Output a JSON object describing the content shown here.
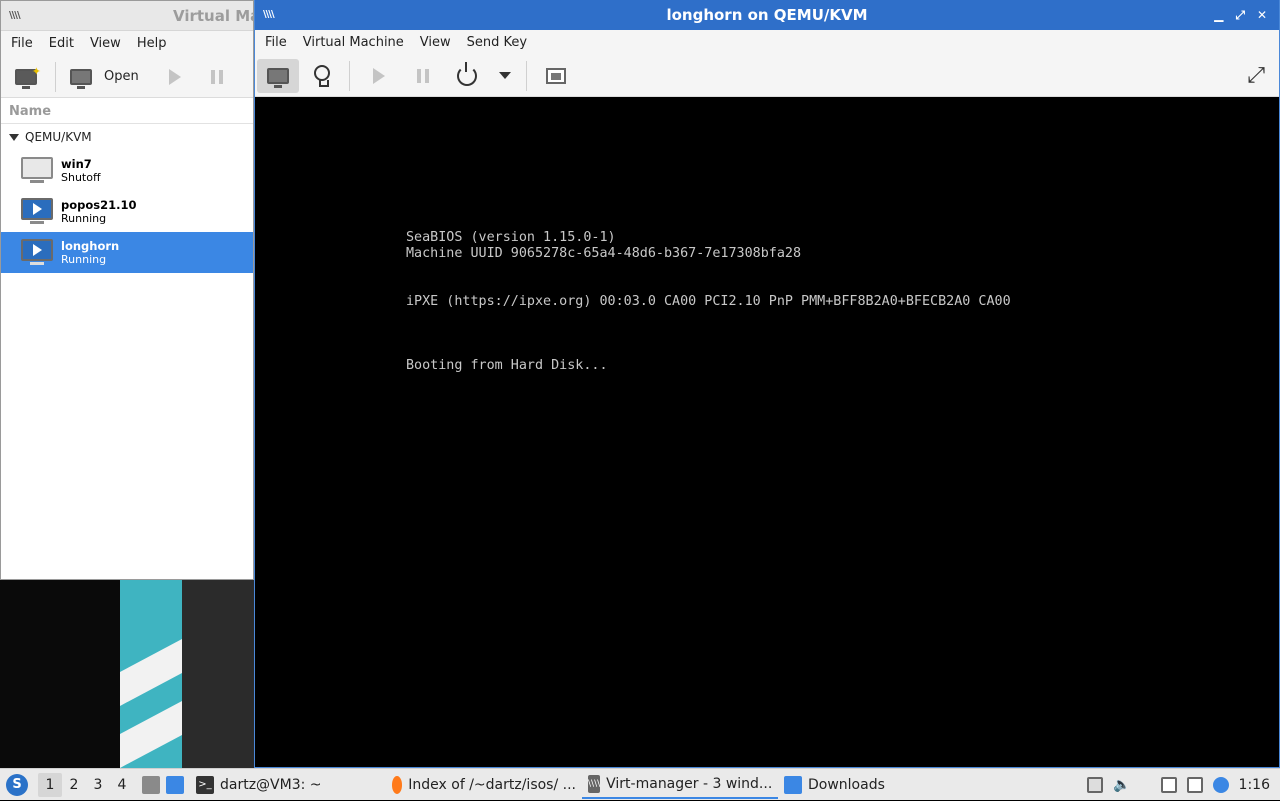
{
  "manager": {
    "title": "Virtual Ma",
    "menu": [
      "File",
      "Edit",
      "View",
      "Help"
    ],
    "toolbar": {
      "open_label": "Open"
    },
    "column_header": "Name",
    "group": "QEMU/KVM",
    "vms": [
      {
        "name": "win7",
        "status": "Shutoff"
      },
      {
        "name": "popos21.10",
        "status": "Running"
      },
      {
        "name": "longhorn",
        "status": "Running"
      }
    ]
  },
  "console_window": {
    "title": "longhorn on QEMU/KVM",
    "menu": [
      "File",
      "Virtual Machine",
      "View",
      "Send Key"
    ],
    "controls": [
      "minimize",
      "maximize",
      "close"
    ],
    "screen_lines": [
      "SeaBIOS (version 1.15.0-1)",
      "Machine UUID 9065278c-65a4-48d6-b367-7e17308bfa28",
      "",
      "",
      "iPXE (https://ipxe.org) 00:03.0 CA00 PCI2.10 PnP PMM+BFF8B2A0+BFECB2A0 CA00",
      "",
      "",
      "",
      "Booting from Hard Disk..."
    ]
  },
  "taskbar": {
    "workspaces": [
      "1",
      "2",
      "3",
      "4"
    ],
    "active_workspace": "1",
    "tasks": [
      {
        "label": "dartz@VM3: ~",
        "icon": "terminal-icon"
      },
      {
        "label": "Index of /~dartz/isos/ ...",
        "icon": "firefox-icon"
      },
      {
        "label": "Virt-manager - 3 wind...",
        "icon": "virt-manager-icon"
      },
      {
        "label": "Downloads",
        "icon": "folder-icon"
      }
    ],
    "clock": "1:16"
  },
  "colors": {
    "accent": "#3b87e4",
    "titlebar_active": "#2f6fc9"
  }
}
